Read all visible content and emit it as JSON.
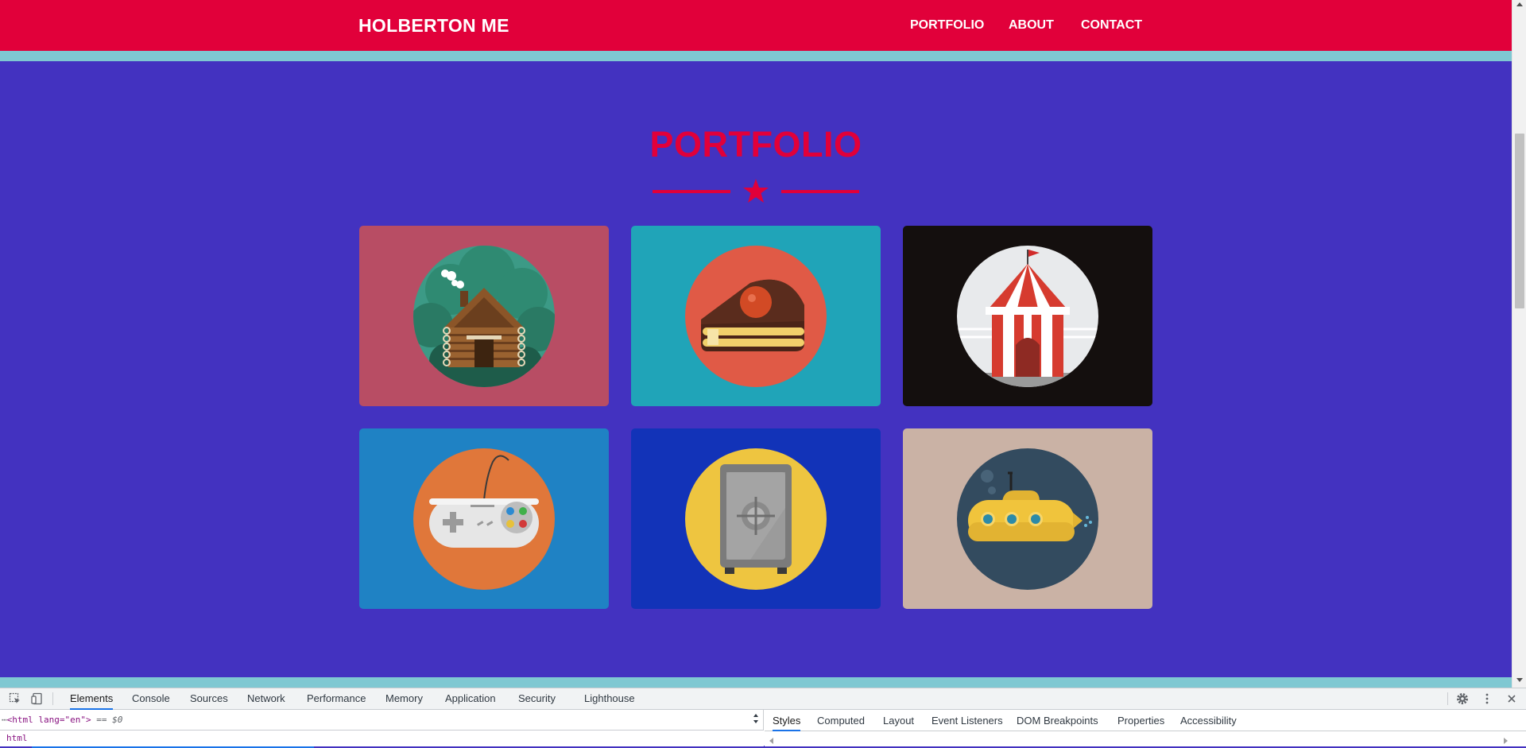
{
  "site": {
    "brand": "HOLBERTON ME",
    "nav": [
      {
        "label": "PORTFOLIO"
      },
      {
        "label": "ABOUT"
      },
      {
        "label": "CONTACT"
      }
    ],
    "section_title": "PORTFOLIO",
    "colors": {
      "nav_bg": "#e1003a",
      "page_bg": "#4332c0",
      "stripe": "#7fc8d2",
      "accent": "#e1003a"
    },
    "portfolio": [
      {
        "subject": "log cabin",
        "icon": "cabin-icon",
        "bg": "#b84d64"
      },
      {
        "subject": "cake slice",
        "icon": "cake-icon",
        "bg": "#20a4b8"
      },
      {
        "subject": "circus tent",
        "icon": "circus-tent-icon",
        "bg": "#140f0e"
      },
      {
        "subject": "game controller",
        "icon": "game-controller-icon",
        "bg": "#1f82c4"
      },
      {
        "subject": "safe",
        "icon": "safe-icon",
        "bg": "#1233b8"
      },
      {
        "subject": "submarine",
        "icon": "submarine-icon",
        "bg": "#cab2a5"
      }
    ]
  },
  "devtools": {
    "tabs": [
      "Elements",
      "Console",
      "Sources",
      "Network",
      "Performance",
      "Memory",
      "Application",
      "Security",
      "Lighthouse"
    ],
    "active_tab": "Elements",
    "dom_line": {
      "prefix": "⋯",
      "open": "<html lang=\"en\">",
      "suffix": " == $0"
    },
    "breadcrumb": "html",
    "style_tabs": [
      "Styles",
      "Computed",
      "Layout",
      "Event Listeners",
      "DOM Breakpoints",
      "Properties",
      "Accessibility"
    ],
    "active_style_tab": "Styles"
  }
}
